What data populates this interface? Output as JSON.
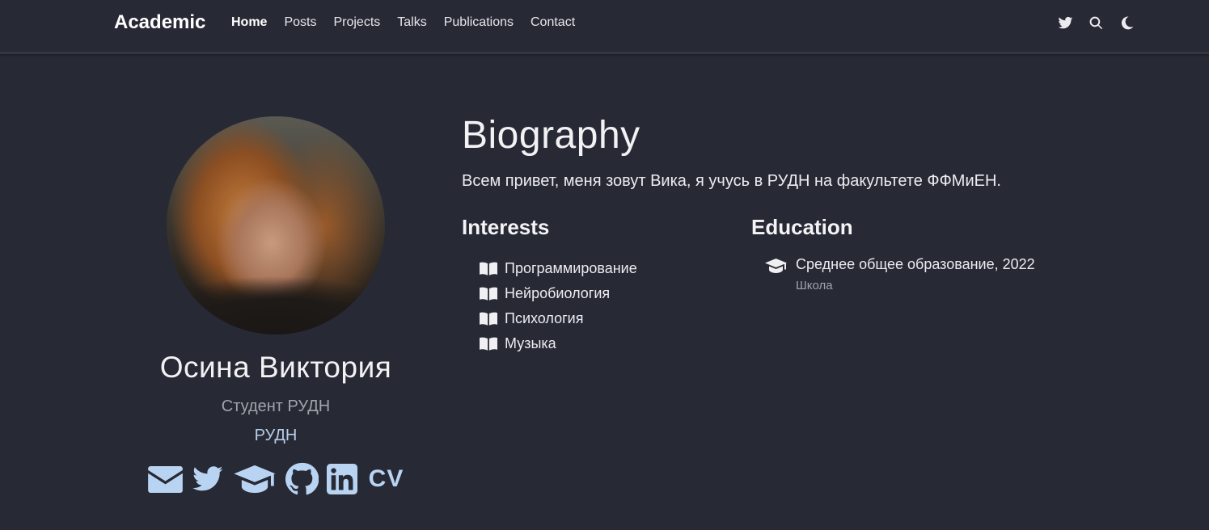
{
  "nav": {
    "brand": "Academic",
    "links": [
      "Home",
      "Posts",
      "Projects",
      "Talks",
      "Publications",
      "Contact"
    ],
    "icons": [
      "twitter-icon",
      "search-icon",
      "moon-icon"
    ]
  },
  "profile": {
    "name": "Осина Виктория",
    "role": "Студент РУДН",
    "organization": "РУДН",
    "social_icons": [
      "envelope-icon",
      "twitter-icon",
      "graduation-cap-icon",
      "github-icon",
      "linkedin-icon"
    ],
    "cv_label": "CV"
  },
  "biography": {
    "title": "Biography",
    "text": "Всем привет, меня зовут Вика, я учусь в РУДН на факультете ФФМиЕН."
  },
  "interests": {
    "title": "Interests",
    "items": [
      "Программирование",
      "Нейробиология",
      "Психология",
      "Музыка"
    ]
  },
  "education": {
    "title": "Education",
    "items": [
      {
        "degree": "Среднее общее образование, 2022",
        "institution": "Школа"
      }
    ]
  },
  "colors": {
    "background": "#272935",
    "accent": "#b9d4f2",
    "muted": "#a2a4ab"
  }
}
